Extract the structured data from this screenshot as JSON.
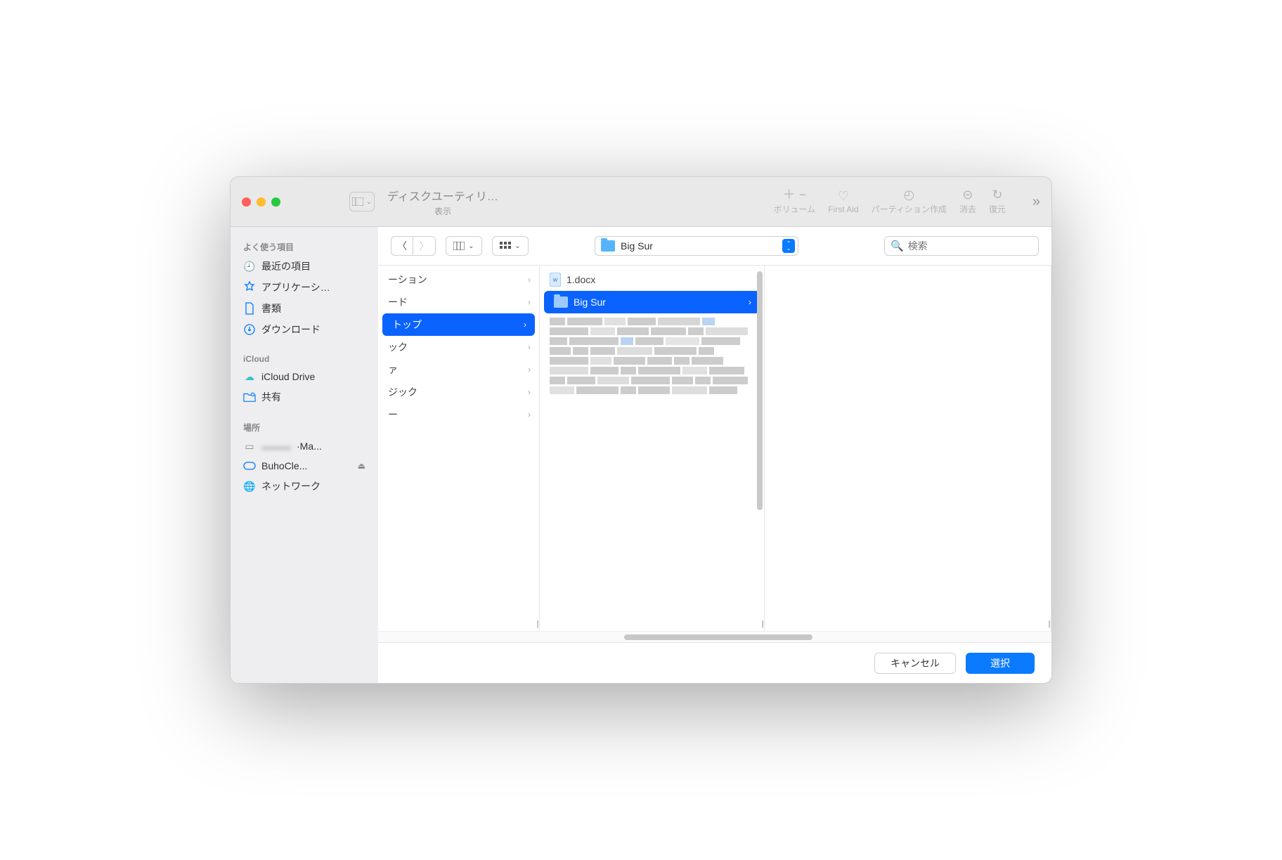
{
  "parent_window": {
    "title": "ディスクユーティリ…",
    "toolbar": {
      "view_label": "表示",
      "volume_label": "ボリューム",
      "firstaid_label": "First Aid",
      "partition_label": "パーティション作成",
      "erase_label": "消去",
      "restore_label": "復元"
    }
  },
  "dialog": {
    "sidebar": {
      "sections": {
        "favorites": {
          "header": "よく使う項目",
          "items": [
            "最近の項目",
            "アプリケーシ…",
            "書類",
            "ダウンロード"
          ]
        },
        "icloud": {
          "header": "iCloud",
          "items": [
            "iCloud Drive",
            "共有"
          ]
        },
        "locations": {
          "header": "場所",
          "items": [
            "·Ma...",
            "BuhoCle...",
            "ネットワーク"
          ]
        }
      }
    },
    "toolbar": {
      "location_label": "Big Sur",
      "search_placeholder": "検索"
    },
    "columns": {
      "c1_items": [
        "ーション",
        "ード",
        "トップ",
        "ック",
        "ァ",
        "ジック",
        "ー"
      ],
      "c1_selected_index": 2,
      "c2_docx": "1.docx",
      "c2_selected": "Big Sur"
    },
    "footer": {
      "cancel": "キャンセル",
      "choose": "選択"
    }
  }
}
